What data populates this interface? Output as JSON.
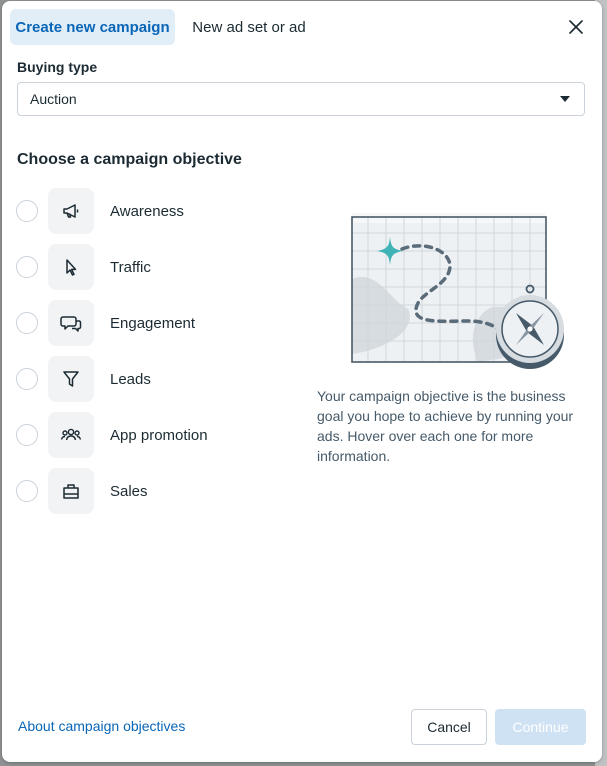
{
  "tabs": [
    {
      "label": "Create new campaign",
      "active": true
    },
    {
      "label": "New ad set or ad",
      "active": false
    }
  ],
  "buying_type": {
    "label": "Buying type",
    "value": "Auction"
  },
  "objective_section": {
    "title": "Choose a campaign objective",
    "items": [
      {
        "label": "Awareness",
        "icon": "megaphone-icon",
        "selected": false
      },
      {
        "label": "Traffic",
        "icon": "cursor-icon",
        "selected": false
      },
      {
        "label": "Engagement",
        "icon": "chat-bubbles-icon",
        "selected": false
      },
      {
        "label": "Leads",
        "icon": "funnel-icon",
        "selected": false
      },
      {
        "label": "App promotion",
        "icon": "people-group-icon",
        "selected": false
      },
      {
        "label": "Sales",
        "icon": "shopping-bag-icon",
        "selected": false
      }
    ]
  },
  "info": {
    "text": "Your campaign objective is the business goal you hope to achieve by running your ads. Hover over each one for more information."
  },
  "footer": {
    "link": "About campaign objectives",
    "cancel": "Cancel",
    "continue": "Continue",
    "continue_disabled": true
  },
  "colors": {
    "accent": "#0a66b7",
    "active_tab_bg": "#e1edf7",
    "disabled_button": "#cfe2f3",
    "illustration_teal": "#3fb3b5"
  }
}
